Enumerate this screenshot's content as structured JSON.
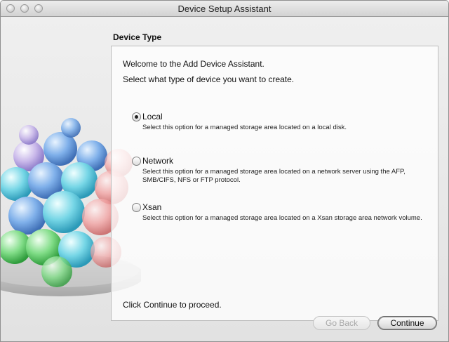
{
  "window": {
    "title": "Device Setup Assistant"
  },
  "section": {
    "title": "Device Type"
  },
  "intro": {
    "line1": "Welcome to the Add Device Assistant.",
    "line2": "Select what type of device you want to create."
  },
  "options": [
    {
      "label": "Local",
      "selected": true,
      "desc": "Select this option for a managed storage area located on a local disk."
    },
    {
      "label": "Network",
      "selected": false,
      "desc": "Select this option for a managed storage area located on a network server using the AFP, SMB/CIFS, NFS or FTP protocol."
    },
    {
      "label": "Xsan",
      "selected": false,
      "desc": "Select this option for a managed storage area located on a Xsan storage area network volume."
    }
  ],
  "footer_text": "Click Continue to proceed.",
  "buttons": {
    "back": "Go Back",
    "continue": "Continue"
  }
}
